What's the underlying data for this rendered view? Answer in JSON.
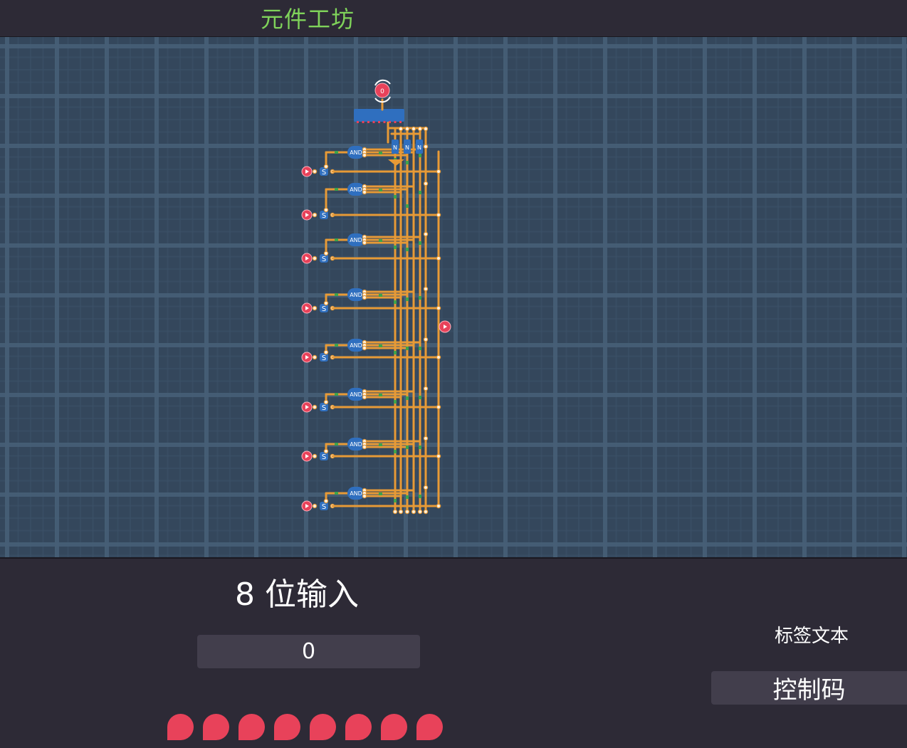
{
  "header": {
    "title": "元件工坊"
  },
  "circuit": {
    "gate_label": "AND",
    "switch_label": "S",
    "selector_label": "0",
    "mux_labels": [
      "N",
      "N",
      "N"
    ],
    "colors": {
      "wire": "#e79a36",
      "gate": "#2f6fbf",
      "pin": "#e8425a",
      "node": "#3ea34a"
    }
  },
  "panel": {
    "component_title": "8  位输入",
    "value": "0",
    "label_text_caption": "标签文本",
    "control_code": "控制码",
    "bit_count": 8
  }
}
